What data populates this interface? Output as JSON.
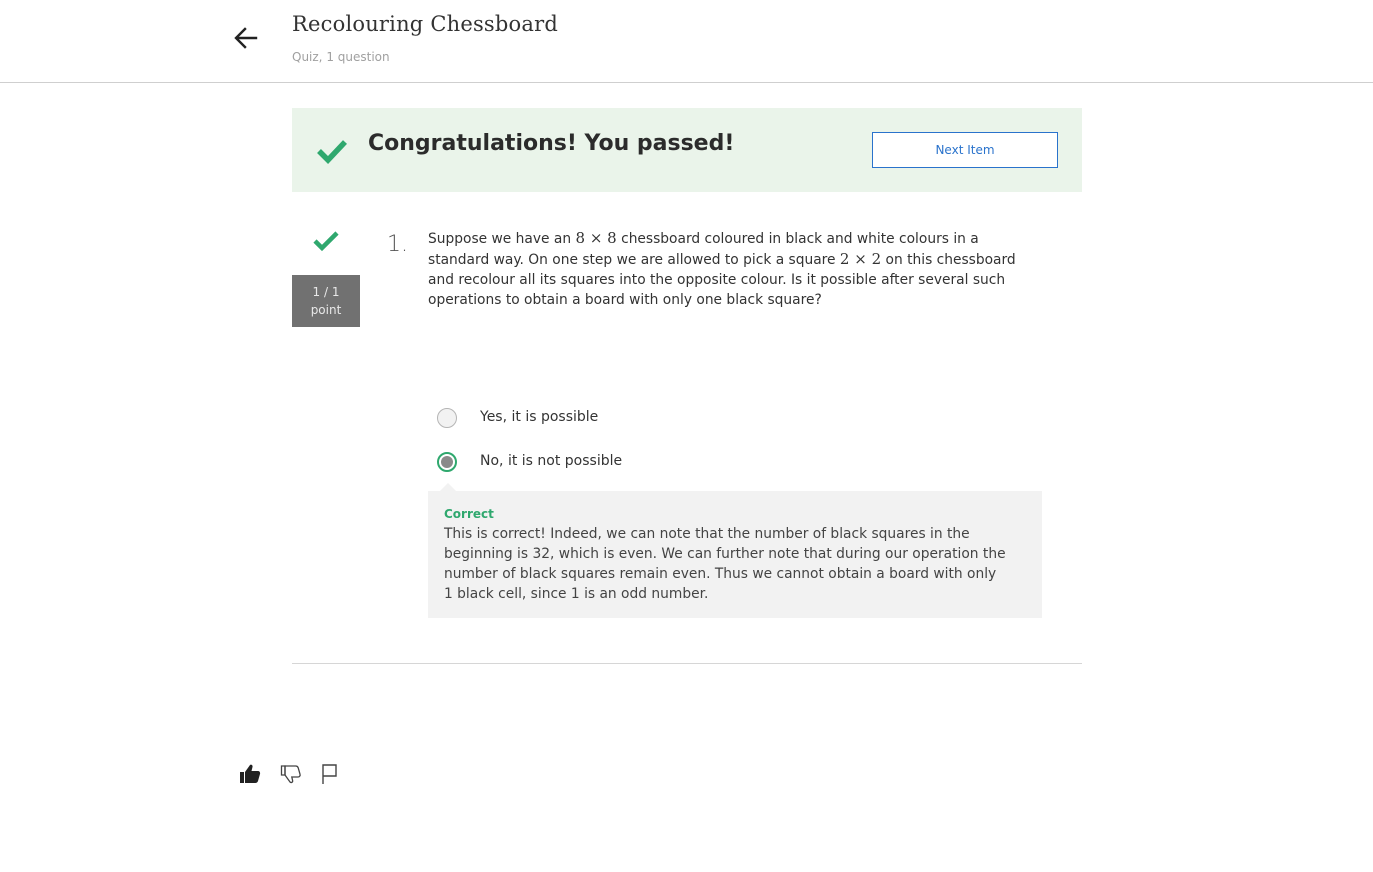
{
  "header": {
    "title": "Recolouring Chessboard",
    "subtitle": "Quiz, 1 question"
  },
  "banner": {
    "message": "Congratulations! You passed!",
    "next_label": "Next Item"
  },
  "question": {
    "number": "1.",
    "points": "1 / 1",
    "points_unit": "point",
    "text_1": "Suppose we have an ",
    "math_1": "8 × 8",
    "text_2": " chessboard coloured in black and white colours in a standard way. On one step we are allowed to pick a square ",
    "math_2": "2 × 2",
    "text_3": " on this chessboard and recolour all its squares into the opposite colour. Is it possible after several such operations to obtain a board with only one black square?"
  },
  "options": [
    {
      "label": "Yes, it is possible",
      "selected": false
    },
    {
      "label": "No, it is not possible",
      "selected": true
    }
  ],
  "feedback": {
    "title": "Correct",
    "text": "This is correct! Indeed, we can note that the number of black squares in the beginning is 32, which is even. We can further note that during our operation the number of black squares remain even. Thus we cannot obtain a board with only 1 black cell, since 1 is an odd number."
  },
  "colors": {
    "success": "#2fa86e",
    "banner_bg": "#eaf4ea",
    "link": "#2a73cc",
    "points_bg": "#717171"
  },
  "icons": [
    "back-arrow-icon",
    "checkmark-icon",
    "thumbs-up-icon",
    "thumbs-down-icon",
    "flag-icon"
  ]
}
